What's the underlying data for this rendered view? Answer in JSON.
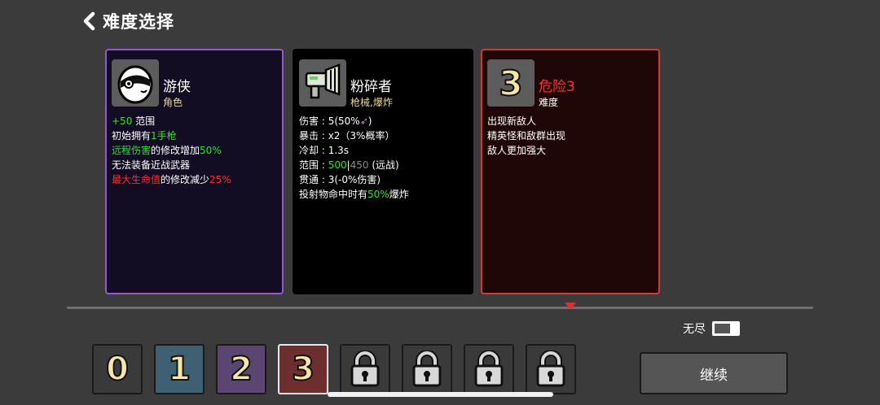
{
  "header": {
    "title": "难度选择"
  },
  "character_card": {
    "name": "游侠",
    "type": "角色",
    "line1_value": "+50",
    "line1_text": " 范围",
    "line2_a": "初始拥有",
    "line2_b": "1手枪",
    "line3_a": "远程伤害",
    "line3_b": "的修改增加",
    "line3_c": "50%",
    "line4": "无法装备近战武器",
    "line5_a": "最大生命值",
    "line5_b": "的修改减少",
    "line5_c": "25%"
  },
  "weapon_card": {
    "name": "粉碎者",
    "type": "枪械,爆炸",
    "damage_label": "伤害 : ",
    "damage_value": "5(50%",
    "damage_close": ")",
    "crit_label": "暴击 : ",
    "crit_value": "x2（3%概率）",
    "cooldown_label": "冷却 : ",
    "cooldown_value": "1.3s",
    "range_label": "范围 : ",
    "range_value": "500",
    "range_sep": "|",
    "range_alt": "450",
    "range_type": " (远战)",
    "pierce_label": "贯通 : ",
    "pierce_value": "3(-0%伤害)",
    "explode_a": "投射物命中时有",
    "explode_b": "50%",
    "explode_c": "爆炸"
  },
  "difficulty_card": {
    "icon_number": "3",
    "name": "危险3",
    "type": "难度",
    "line1": "出现新敌人",
    "line2": "精英怪和敌群出现",
    "line3": "敌人更加强大"
  },
  "endless": {
    "label": "无尽"
  },
  "difficulty_slots": [
    {
      "label": "0",
      "color": "#3a3a3a"
    },
    {
      "label": "1",
      "color": "#3f5f72"
    },
    {
      "label": "2",
      "color": "#5a4670"
    },
    {
      "label": "3",
      "color": "#6e2e2e"
    }
  ],
  "locked_slots_count": 4,
  "continue_button": {
    "label": "继续"
  },
  "colors": {
    "accent_green": "#2fe02f",
    "accent_red": "#ff2c2c",
    "selected_border": "#d23a3a",
    "character_border": "#8f5ad6"
  }
}
